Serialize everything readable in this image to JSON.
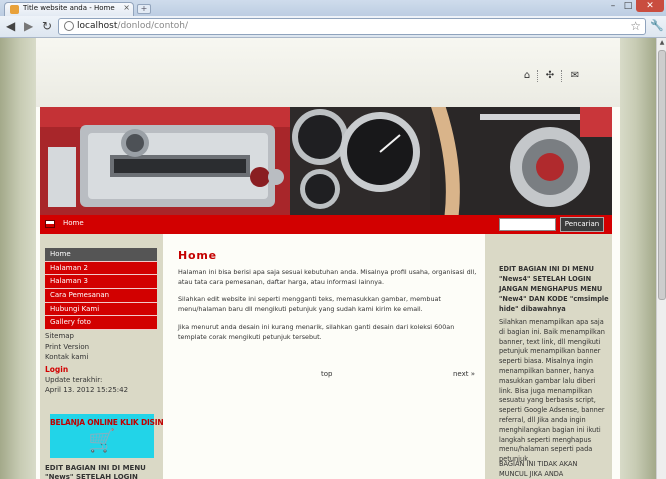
{
  "browser": {
    "tab_title": "Title website anda - Home",
    "tab_close": "×",
    "new_tab": "+",
    "url_host": "localhost",
    "url_path": "/donlod/contoh/"
  },
  "header": {
    "home_icon": "home-icon",
    "sitemap_icon": "sitemap-icon",
    "mail_icon": "mail-icon"
  },
  "navbar": {
    "home_label": "Home",
    "search_button": "Pencarian"
  },
  "sidebar": {
    "menu": [
      "Home",
      "Halaman 2",
      "Halaman 3",
      "Cara Pemesanan",
      "Hubungi Kami",
      "Gallery foto"
    ],
    "links": [
      "Sitemap",
      "Print Version",
      "Kontak kami"
    ],
    "login_heading": "Login",
    "update_label": "Update terakhir:",
    "update_date": "April 13. 2012 15:25:42",
    "ad_text": "BELANJA ONLINE KLIK DISINI",
    "note": "EDIT BAGIAN INI DI MENU \"News\" SETELAH LOGIN"
  },
  "main": {
    "title": "Home",
    "paragraphs": [
      "Halaman ini bisa berisi apa saja sesuai kebutuhan anda. Misalnya profil usaha, organisasi dll, atau tata cara pemesanan, daftar harga, atau informasi lainnya.",
      "Silahkan edit website ini seperti mengganti teks, memasukkan gambar, membuat menu/halaman baru dll mengikuti petunjuk yang sudah kami kirim ke email.",
      "Jika menurut anda desain ini kurang menarik, silahkan ganti desain dari koleksi 600an template corak mengikuti petunjuk tersebut."
    ],
    "top_link": "top",
    "next_link": "next »"
  },
  "right": {
    "heading": "EDIT BAGIAN INI DI MENU \"News4\" SETELAH LOGIN JANGAN MENGHAPUS MENU \"New4\" DAN KODE \"cmsimple hide\" dibawahnya",
    "body": "Silahkan menampilkan apa saja di bagian ini. Baik menampilkan banner, text link, dll mengikuti petunjuk menampilkan banner seperti biasa. Misalnya ingin menampilkan banner, hanya masukkan gambar lalu diberi link. Bisa juga menampilkan sesuatu yang berbasis script, seperti Google Adsense, banner referral, dll Jika anda ingin menghilangkan bagian ini ikuti langkah seperti menghapus menu/halaman seperti pada petunjuk.",
    "footer": "BAGIAN INI TIDAK AKAN MUNCUL JIKA ANDA"
  }
}
